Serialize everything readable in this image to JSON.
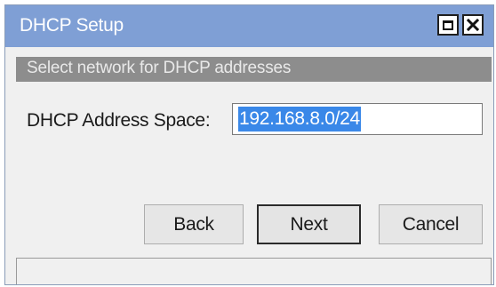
{
  "window": {
    "title": "DHCP Setup",
    "controls": {
      "maximize_icon": "maximize-icon",
      "close_icon": "close-icon"
    }
  },
  "banner": {
    "text": "Select network for DHCP addresses"
  },
  "form": {
    "address_space_label": "DHCP Address Space:",
    "address_space_value": "192.168.8.0/24",
    "value_selected": true
  },
  "buttons": {
    "back": "Back",
    "next": "Next",
    "cancel": "Cancel"
  },
  "colors": {
    "titlebar": "#7f9fd5",
    "banner": "#8d8d8d",
    "selection": "#3a88e8"
  }
}
